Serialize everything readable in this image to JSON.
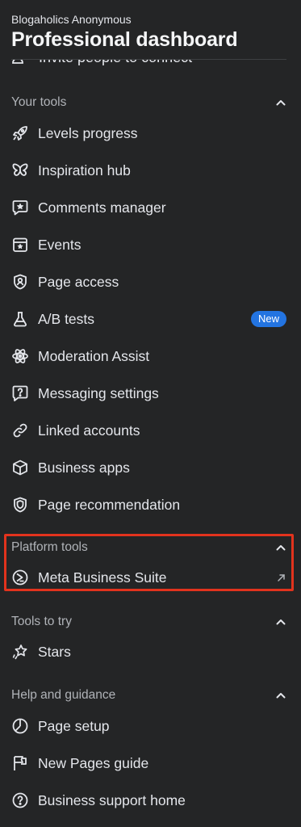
{
  "header": {
    "page_name": "Blogaholics Anonymous",
    "title": "Professional dashboard"
  },
  "partial_item": {
    "label": "Invite people to connect",
    "icon": "people-icon"
  },
  "sections": {
    "your_tools": {
      "label": "Your tools",
      "items": [
        {
          "label": "Levels progress",
          "icon": "rocket-icon"
        },
        {
          "label": "Inspiration hub",
          "icon": "butterfly-icon"
        },
        {
          "label": "Comments manager",
          "icon": "comment-star-icon"
        },
        {
          "label": "Events",
          "icon": "calendar-star-icon"
        },
        {
          "label": "Page access",
          "icon": "shield-person-icon"
        },
        {
          "label": "A/B tests",
          "icon": "flask-icon",
          "badge": "New"
        },
        {
          "label": "Moderation Assist",
          "icon": "atom-icon"
        },
        {
          "label": "Messaging settings",
          "icon": "message-question-icon"
        },
        {
          "label": "Linked accounts",
          "icon": "link-icon"
        },
        {
          "label": "Business apps",
          "icon": "cube-icon"
        },
        {
          "label": "Page recommendation",
          "icon": "shield-badge-icon"
        }
      ]
    },
    "platform_tools": {
      "label": "Platform tools",
      "items": [
        {
          "label": "Meta Business Suite",
          "icon": "meta-business-suite-icon",
          "external": true
        }
      ]
    },
    "tools_to_try": {
      "label": "Tools to try",
      "items": [
        {
          "label": "Stars",
          "icon": "stars-icon"
        }
      ]
    },
    "help": {
      "label": "Help and guidance",
      "items": [
        {
          "label": "Page setup",
          "icon": "pie-chart-icon"
        },
        {
          "label": "New Pages guide",
          "icon": "flag-icon"
        },
        {
          "label": "Business support home",
          "icon": "question-circle-icon"
        }
      ]
    }
  },
  "colors": {
    "background": "#242526",
    "text": "#e4e6eb",
    "secondary_text": "#b0b3b8",
    "badge": "#2374e1",
    "annotation": "#e2331d"
  }
}
